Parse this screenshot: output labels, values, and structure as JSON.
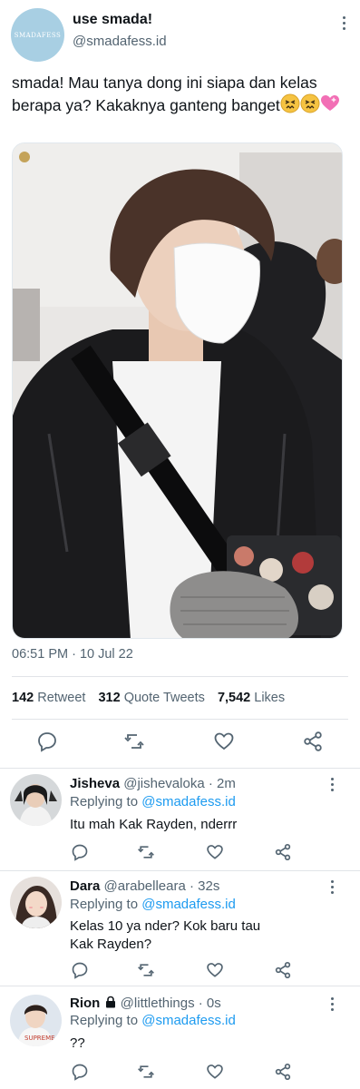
{
  "tweet": {
    "avatar_text": "SMADAFESS",
    "display_name": "use smada!",
    "handle": "@smadafess.id",
    "text": "smada! Mau tanya dong ini siapa dan kelas berapa ya? Kakaknya ganteng banget",
    "emojis": [
      "confounded-face",
      "confounded-face",
      "pink-heart"
    ],
    "timestamp": "06:51 PM · 10 Jul 22"
  },
  "stats": {
    "retweets_count": "142",
    "retweets_label": "Retweet",
    "quotes_count": "312",
    "quotes_label": "Quote Tweets",
    "likes_count": "7,542",
    "likes_label": "Likes"
  },
  "actions": [
    "reply-icon",
    "retweet-icon",
    "like-icon",
    "share-icon"
  ],
  "colors": {
    "text": "#0f1419",
    "secondary": "#536471",
    "link": "#1d9bf0",
    "divider": "#e1e4e8"
  },
  "replies": [
    {
      "name": "Jisheva",
      "handle": "@jishevaloka · 2m",
      "replying_label": "Replying to",
      "replying_to": "@smadafess.id",
      "text": "Itu mah Kak Rayden, nderrr"
    },
    {
      "name": "Dara",
      "handle": "@arabelleara · 32s",
      "replying_label": "Replying to",
      "replying_to": "@smadafess.id",
      "text": "Kelas 10 ya nder? Kok baru tau Kak Rayden?"
    },
    {
      "name": "Rion",
      "handle": "@littlethings · 0s",
      "replying_label": "Replying to",
      "replying_to": "@smadafess.id",
      "text": "??",
      "locked": true
    }
  ]
}
